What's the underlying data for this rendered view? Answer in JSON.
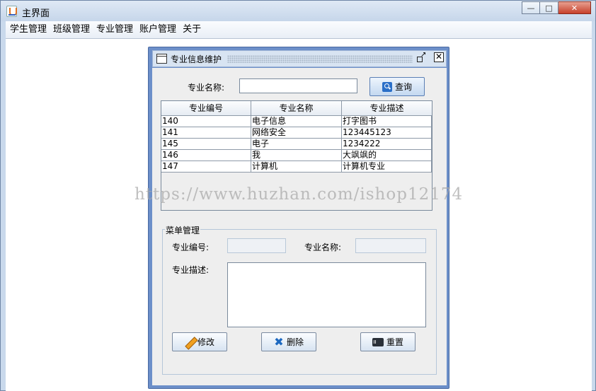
{
  "window": {
    "title": "主界面",
    "caption": {
      "minimize": "—",
      "maximize": "□",
      "close": "✕"
    }
  },
  "menu": [
    {
      "label": "学生管理"
    },
    {
      "label": "班级管理"
    },
    {
      "label": "专业管理"
    },
    {
      "label": "账户管理"
    },
    {
      "label": "关于"
    }
  ],
  "frame": {
    "title": "专业信息维护",
    "close_glyph": "✕"
  },
  "search": {
    "label": "专业名称:",
    "value": "",
    "button_label": "查询"
  },
  "table": {
    "columns": [
      "专业编号",
      "专业名称",
      "专业描述"
    ],
    "rows": [
      [
        "140",
        "电子信息",
        "打字图书"
      ],
      [
        "141",
        "网络安全",
        "123445123"
      ],
      [
        "145",
        "电子",
        "1234222"
      ],
      [
        "146",
        "我",
        "大飒飒的"
      ],
      [
        "147",
        "计算机",
        "计算机专业"
      ]
    ]
  },
  "form": {
    "legend": "菜单管理",
    "id_label": "专业编号:",
    "id_value": "",
    "name_label": "专业名称:",
    "name_value": "",
    "desc_label": "专业描述:",
    "desc_value": "",
    "edit_label": "修改",
    "delete_label": "删除",
    "reset_label": "重置"
  },
  "watermark": "https://www.huzhan.com/ishop12174"
}
